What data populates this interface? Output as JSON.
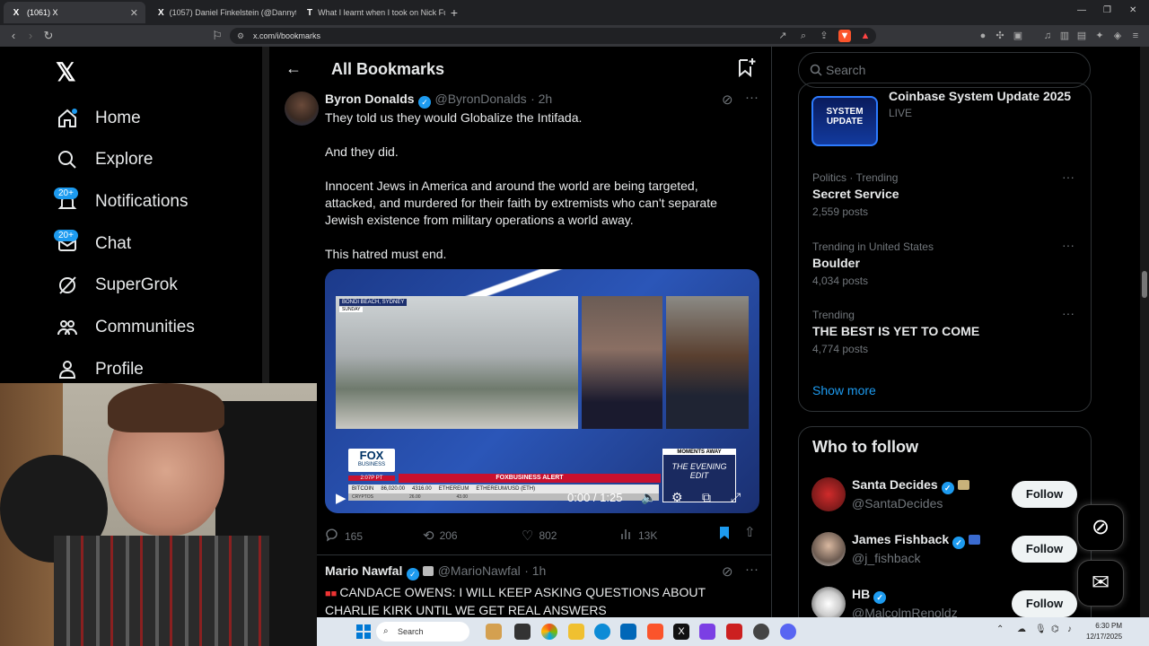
{
  "browser": {
    "tabs": [
      {
        "label": "(1061) X",
        "favicon": "X"
      },
      {
        "label": "(1057) Daniel Finkelstein (@Dannyth...",
        "favicon": "X"
      },
      {
        "label": "What I learnt when I took on Nick Fu...",
        "favicon": "T"
      }
    ],
    "url": "x.com/i/bookmarks"
  },
  "nav": {
    "items": [
      {
        "label": "Home",
        "icon": "home-icon"
      },
      {
        "label": "Explore",
        "icon": "search-icon"
      },
      {
        "label": "Notifications",
        "icon": "bell-icon",
        "badge": "20+"
      },
      {
        "label": "Chat",
        "icon": "mail-icon",
        "badge": "20+"
      },
      {
        "label": "SuperGrok",
        "icon": "grok-icon"
      },
      {
        "label": "Communities",
        "icon": "communities-icon"
      },
      {
        "label": "Profile",
        "icon": "profile-icon"
      }
    ]
  },
  "main": {
    "title": "All Bookmarks",
    "tweets": [
      {
        "name": "Byron Donalds",
        "handle": "@ByronDonalds",
        "time": "· 2h",
        "text": "They told us they would Globalize the Intifada.\n\nAnd they did.\n\nInnocent Jews in America and around the world are being targeted, attacked, and murdered for their faith by extremists who can't separate Jewish existence from military operations a world away.\n\nThis hatred must end.",
        "video": {
          "time": "0:00 / 1:25",
          "chyron_top": "BONDI BEACH, SYDNEY",
          "chyron_sub": "SUNDAY",
          "network": "FOX",
          "network_sub": "BUSINESS",
          "clock": "2:07P PT",
          "alert": "FOXBUSINESS ALERT",
          "ticker": [
            "BITCOIN",
            "86,020.00",
            "4316.00",
            "ETHEREUM",
            "ETHEREUM/USD (ETH)"
          ],
          "ticker_sub": [
            "CRYPTOS",
            "26.00",
            "43.00"
          ],
          "promo_top": "MOMENTS AWAY",
          "promo_title": "THE EVENING EDIT"
        },
        "replies": "165",
        "reposts": "206",
        "likes": "802",
        "views": "13K"
      },
      {
        "name": "Mario Nawfal",
        "handle": "@MarioNawfal",
        "time": "· 1h",
        "text": "CANDACE OWENS: I WILL KEEP ASKING QUESTIONS ABOUT CHARLIE KIRK UNTIL WE GET REAL ANSWERS"
      }
    ]
  },
  "right": {
    "search_placeholder": "Search",
    "live": {
      "title": "Coinbase System Update 2025",
      "status": "LIVE",
      "thumb_line1": "SYSTEM",
      "thumb_line2": "UPDATE"
    },
    "trends": [
      {
        "category": "Politics · Trending",
        "topic": "Secret Service",
        "posts": "2,559 posts"
      },
      {
        "category": "Trending in United States",
        "topic": "Boulder",
        "posts": "4,034 posts"
      },
      {
        "category": "Trending",
        "topic": "THE BEST IS YET TO COME",
        "posts": "4,774 posts"
      }
    ],
    "show_more": "Show more",
    "who_to_follow_title": "Who to follow",
    "follow": [
      {
        "name": "Santa Decides",
        "handle": "@SantaDecides",
        "button": "Follow"
      },
      {
        "name": "James Fishback",
        "handle": "@j_fishback",
        "button": "Follow"
      },
      {
        "name": "HB",
        "handle": "@MalcolmRenoldz",
        "button": "Follow"
      }
    ]
  },
  "taskbar": {
    "search": "Search",
    "time": "6:30 PM",
    "date": "12/17/2025"
  },
  "colors": {
    "accent": "#1d9bf0",
    "background": "#000000"
  }
}
